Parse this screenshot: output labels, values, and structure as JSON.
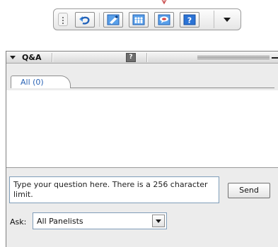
{
  "toolbar": {
    "buttons": [
      {
        "icon": "undo-arrow-icon",
        "label": ""
      },
      {
        "icon": "annotate-icon",
        "label": ""
      },
      {
        "icon": "participants-icon",
        "label": ""
      },
      {
        "icon": "chat-icon",
        "label": ""
      },
      {
        "icon": "help-icon",
        "label": "?"
      }
    ],
    "dropdown_icon": "chevron-down-icon",
    "marker_icon": "pointer-marker-icon"
  },
  "panel": {
    "title": "Q&A",
    "help_label": "?",
    "tabs": [
      {
        "label": "All (0)",
        "selected": true
      }
    ],
    "question_placeholder": "Type your question here. There is a 256 character limit.",
    "send_label": "Send",
    "ask_label": "Ask:",
    "ask_value": "All Panelists"
  },
  "colors": {
    "tab_text": "#2a63b5",
    "help_bg": "#6d6d6d",
    "toolbar_icon_blue": "#1e6fd0"
  }
}
